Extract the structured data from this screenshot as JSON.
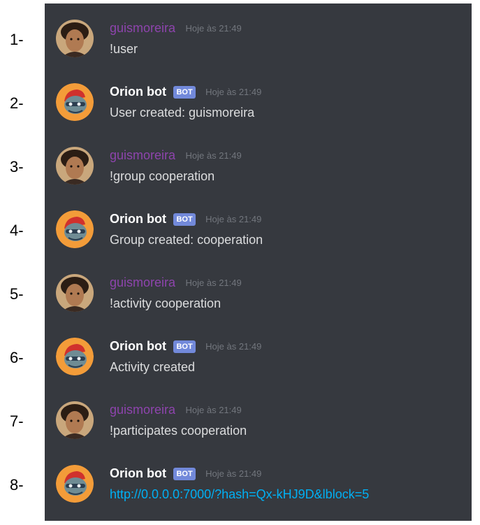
{
  "numbers": [
    "1-",
    "2-",
    "3-",
    "4-",
    "5-",
    "6-",
    "7-",
    "8-"
  ],
  "messages": [
    {
      "author": "guismoreira",
      "time": "Hoje às 21:49",
      "text": "!user"
    },
    {
      "author": "Orion bot",
      "badge": "BOT",
      "time": "Hoje às 21:49",
      "text": "User created: guismoreira"
    },
    {
      "author": "guismoreira",
      "time": "Hoje às 21:49",
      "text": "!group cooperation"
    },
    {
      "author": "Orion bot",
      "badge": "BOT",
      "time": "Hoje às 21:49",
      "text": "Group created: cooperation"
    },
    {
      "author": "guismoreira",
      "time": "Hoje às 21:49",
      "text": "!activity cooperation"
    },
    {
      "author": "Orion bot",
      "badge": "BOT",
      "time": "Hoje às 21:49",
      "text": "Activity created"
    },
    {
      "author": "guismoreira",
      "time": "Hoje às 21:49",
      "text": "!participates cooperation"
    },
    {
      "author": "Orion bot",
      "badge": "BOT",
      "time": "Hoje às 21:49",
      "text": "http://0.0.0.0:7000/?hash=Qx-kHJ9D&lblock=5"
    }
  ],
  "colors": {
    "background": "#36393f",
    "user_name": "#8e44ad",
    "bot_name": "#ffffff",
    "badge": "#7289da",
    "message_text": "#dcddde",
    "link": "#00b0f4",
    "timestamp": "#72767d"
  }
}
